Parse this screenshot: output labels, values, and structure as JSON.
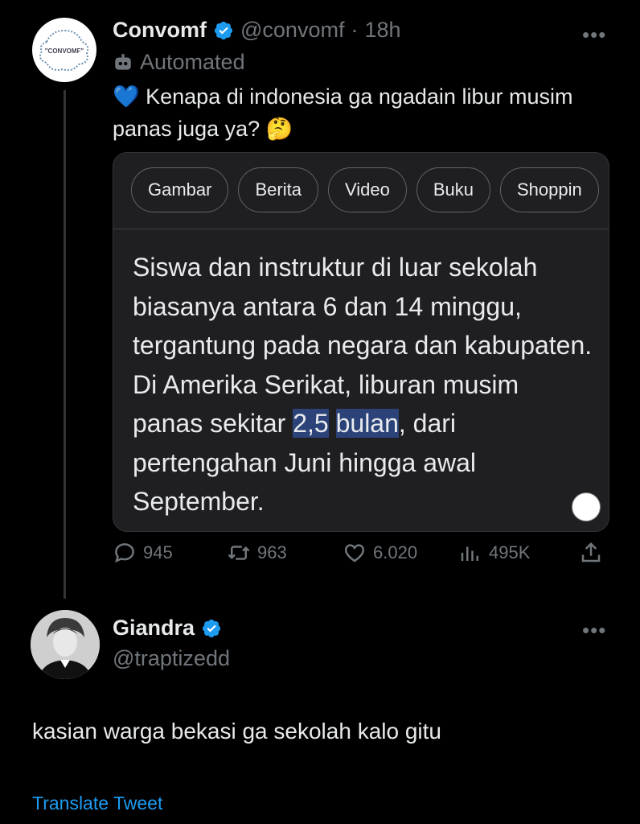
{
  "tweet1": {
    "name": "Convomf",
    "handle": "@convomf",
    "time": "18h",
    "separator": "·",
    "automated_label": "Automated",
    "avatar_text": "\"CONVOMF\"",
    "text_line1": "💙 Kenapa di indonesia ga ngadain libur musim",
    "text_line2": "panas juga ya? 🤔",
    "card": {
      "chips": [
        "Gambar",
        "Berita",
        "Video",
        "Buku",
        "Shoppin"
      ],
      "snippet_before": "Siswa dan instruktur di luar sekolah biasanya antara 6 dan 14 minggu, tergantung pada negara dan kabupaten. Di Amerika Serikat, liburan musim panas sekitar ",
      "snippet_highlight1": "2,5",
      "snippet_highlight2": "bulan",
      "snippet_after": ", dari pertengahan Juni hingga awal September."
    },
    "actions": {
      "replies": "945",
      "retweets": "963",
      "likes": "6.020",
      "views": "495K"
    }
  },
  "tweet2": {
    "name": "Giandra",
    "handle": "@traptizedd",
    "text": "kasian warga bekasi ga sekolah kalo gitu",
    "translate": "Translate Tweet"
  },
  "more_label": "•••",
  "colors": {
    "background": "#000000",
    "text": "#e7e9ea",
    "muted": "#71767b",
    "accent": "#1d9bf0",
    "highlight": "#2b4378"
  }
}
